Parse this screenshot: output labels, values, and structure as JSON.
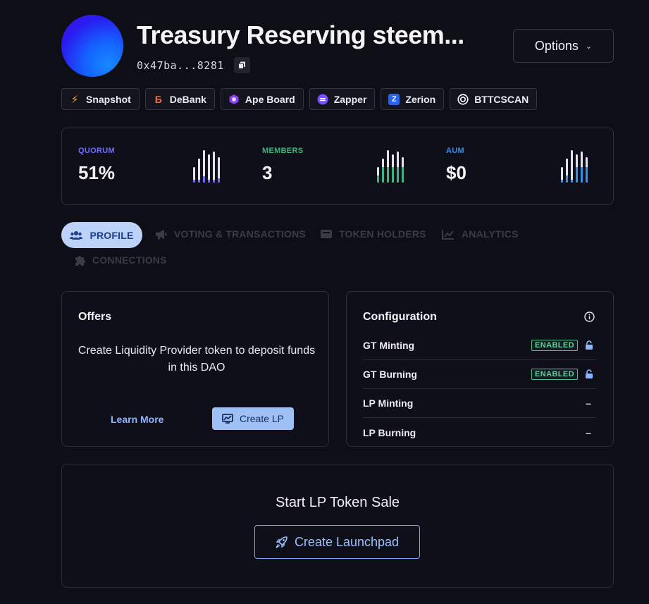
{
  "header": {
    "title": "Treasury Reserving steem...",
    "address": "0x47ba...8281",
    "options_label": "Options"
  },
  "links": [
    {
      "label": "Snapshot",
      "icon": "snapshot-icon",
      "color": "#f5a623"
    },
    {
      "label": "DeBank",
      "icon": "debank-icon",
      "color": "#ff6b3d"
    },
    {
      "label": "Ape Board",
      "icon": "apeboard-icon",
      "color": "#8b3df5"
    },
    {
      "label": "Zapper",
      "icon": "zapper-icon",
      "color": "#784ffe"
    },
    {
      "label": "Zerion",
      "icon": "zerion-icon",
      "color": "#2962ef"
    },
    {
      "label": "BTTCSCAN",
      "icon": "bttcscan-icon",
      "color": "#ffffff"
    }
  ],
  "stats": {
    "quorum": {
      "label": "QUORUM",
      "value": "51%",
      "color": "#6f6bff"
    },
    "members": {
      "label": "MEMBERS",
      "value": "3",
      "color": "#3fb37f"
    },
    "aum": {
      "label": "AUM",
      "value": "$0",
      "color": "#3a8ee6"
    }
  },
  "tabs": [
    {
      "label": "PROFILE",
      "icon": "users-icon",
      "active": true
    },
    {
      "label": "VOTING & TRANSACTIONS",
      "icon": "megaphone-icon",
      "active": false
    },
    {
      "label": "TOKEN HOLDERS",
      "icon": "wallet-icon",
      "active": false
    },
    {
      "label": "ANALYTICS",
      "icon": "chart-line-icon",
      "active": false
    },
    {
      "label": "CONNECTIONS",
      "icon": "puzzle-icon",
      "active": false
    }
  ],
  "offers": {
    "title": "Offers",
    "text": "Create Liquidity Provider token to deposit funds in this DAO",
    "learn_more": "Learn More",
    "create_lp": "Create LP"
  },
  "configuration": {
    "title": "Configuration",
    "rows": [
      {
        "label": "GT Minting",
        "status": "ENABLED"
      },
      {
        "label": "GT Burning",
        "status": "ENABLED"
      },
      {
        "label": "LP Minting",
        "status": "–"
      },
      {
        "label": "LP Burning",
        "status": "–"
      }
    ]
  },
  "launchpad": {
    "title": "Start LP Token Sale",
    "button": "Create Launchpad"
  }
}
